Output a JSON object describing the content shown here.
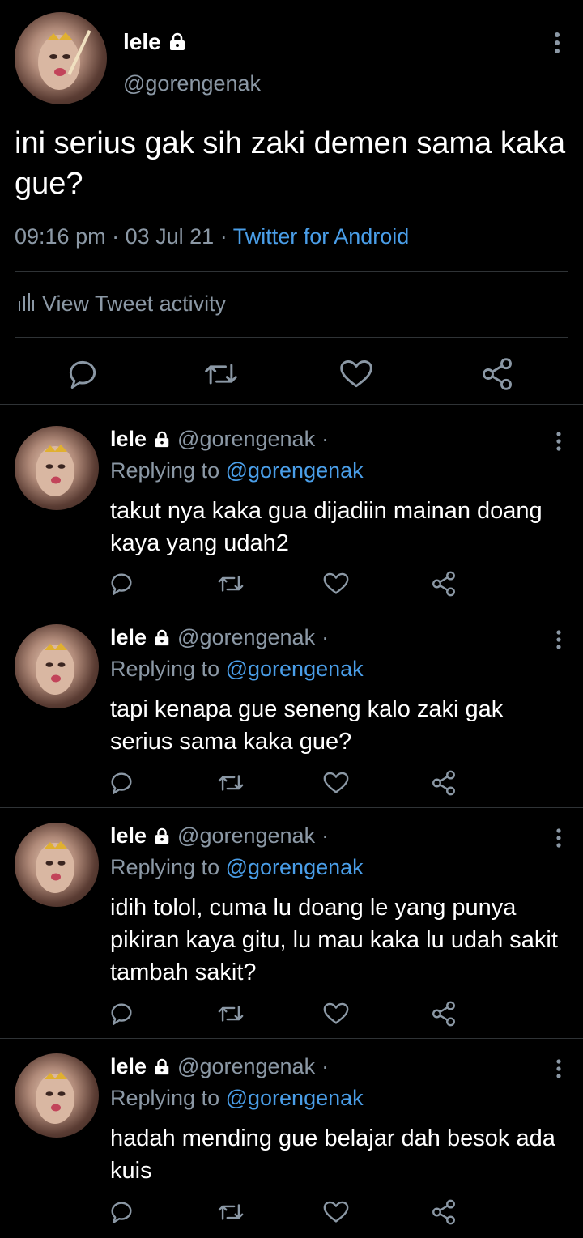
{
  "colors": {
    "background": "#000000",
    "text": "#ffffff",
    "secondary": "#8b98a5",
    "link": "#4a9ee8",
    "divider": "#2f3336"
  },
  "main_tweet": {
    "name": "lele",
    "handle": "@gorengenak",
    "text": "ini serius gak sih zaki demen sama kaka gue?",
    "time": "09:16 pm",
    "date": "03 Jul 21",
    "client": "Twitter for Android",
    "activity_label": "View Tweet activity",
    "icons": [
      "reply-icon",
      "retweet-icon",
      "like-icon",
      "share-icon"
    ]
  },
  "replies": [
    {
      "name": "lele",
      "handle": "@gorengenak",
      "replying_prefix": "Replying to",
      "replying_to": "@gorengenak",
      "text": "takut nya kaka gua dijadiin mainan doang kaya yang udah2"
    },
    {
      "name": "lele",
      "handle": "@gorengenak",
      "replying_prefix": "Replying to",
      "replying_to": "@gorengenak",
      "text": "tapi kenapa gue seneng kalo zaki gak serius sama kaka gue?"
    },
    {
      "name": "lele",
      "handle": "@gorengenak",
      "replying_prefix": "Replying to",
      "replying_to": "@gorengenak",
      "text": "idih tolol, cuma lu doang le yang punya pikiran kaya gitu, lu mau kaka lu udah sakit tambah sakit?"
    },
    {
      "name": "lele",
      "handle": "@gorengenak",
      "replying_prefix": "Replying to",
      "replying_to": "@gorengenak",
      "text": "hadah mending gue belajar dah besok ada kuis"
    }
  ]
}
